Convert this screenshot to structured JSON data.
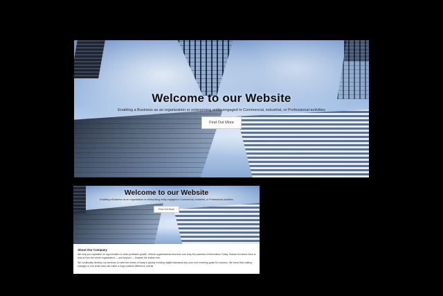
{
  "hero": {
    "title": "Welcome to our Website",
    "subtitle": "Enabling a Business as an organization or enterprising entity engaged in Commercial, industrial, or Professional activities",
    "cta_label": "Find Out More"
  },
  "about": {
    "heading": "About Our Company",
    "paragraph_1": "We help you capitalise on opportunities to drive profitable growth, rethink organisational structure and reap the potential of information.Today, finance functions have to look at how the whole organisation — and beyond — impacts the bottom line.",
    "paragraph_2": "We continually develop our services to meet the needs of today's quickly evolving digital standards and your ever evolving goals for success. We know that making changes in one small area can make a huge positive difference overall."
  },
  "colors": {
    "background": "#000000",
    "page": "#ffffff",
    "title": "#111111"
  }
}
